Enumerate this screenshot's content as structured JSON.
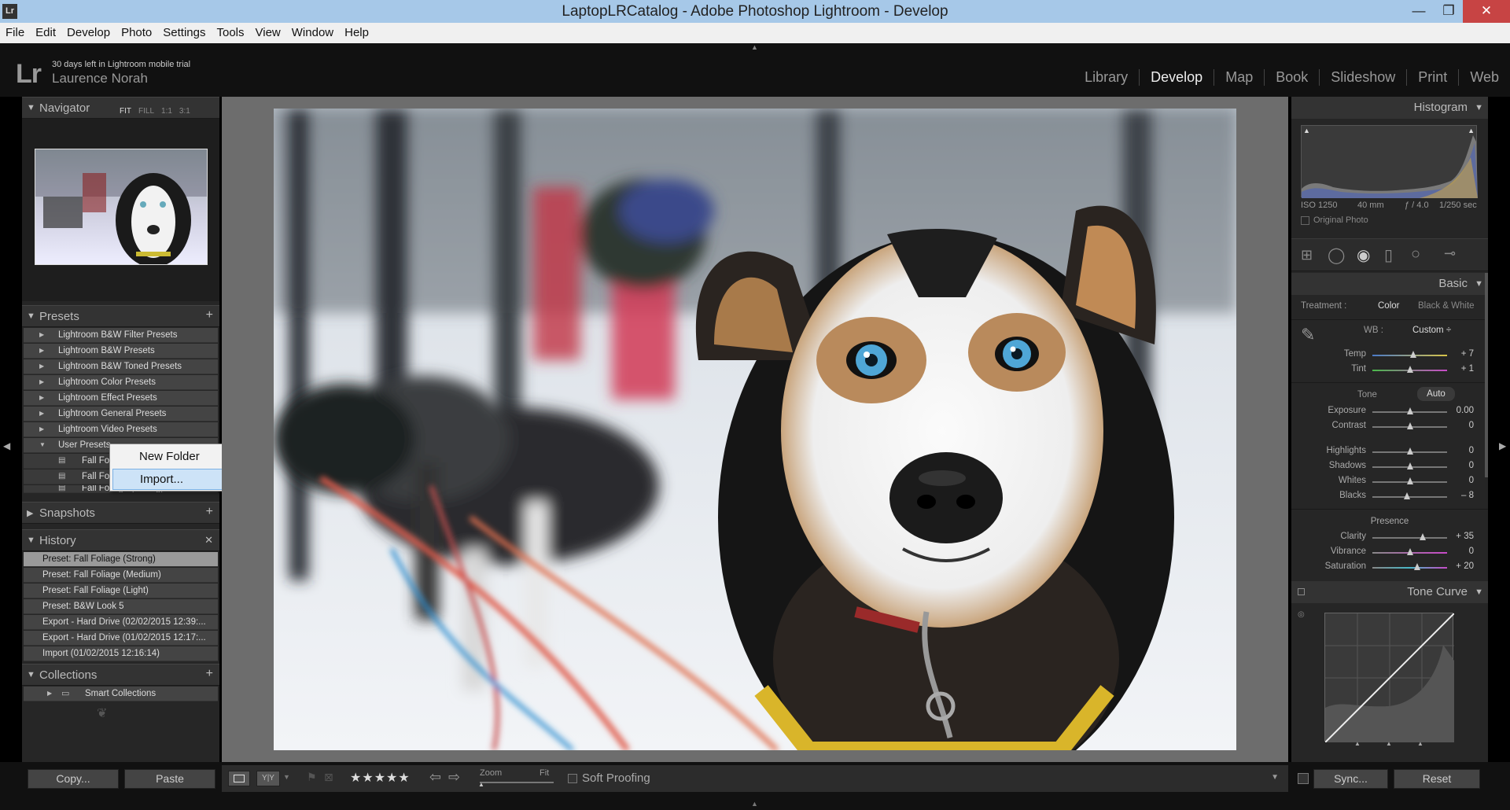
{
  "window": {
    "title": "LaptopLRCatalog - Adobe Photoshop Lightroom - Develop",
    "app_icon": "Lr",
    "minimize": "—",
    "maximize": "❐",
    "close": "✕"
  },
  "menu": [
    "File",
    "Edit",
    "Develop",
    "Photo",
    "Settings",
    "Tools",
    "View",
    "Window",
    "Help"
  ],
  "identity": {
    "logo": "Lr",
    "trial_text": "30 days left in Lightroom mobile trial",
    "user_name": "Laurence Norah"
  },
  "modules": [
    {
      "label": "Library",
      "active": false
    },
    {
      "label": "Develop",
      "active": true
    },
    {
      "label": "Map",
      "active": false
    },
    {
      "label": "Book",
      "active": false
    },
    {
      "label": "Slideshow",
      "active": false
    },
    {
      "label": "Print",
      "active": false
    },
    {
      "label": "Web",
      "active": false
    }
  ],
  "navigator": {
    "title": "Navigator",
    "zoom_options": [
      "FIT",
      "FILL",
      "1:1",
      "3:1"
    ]
  },
  "presets": {
    "title": "Presets",
    "folders": [
      "Lightroom B&W Filter Presets",
      "Lightroom B&W Presets",
      "Lightroom B&W Toned Presets",
      "Lightroom Color Presets",
      "Lightroom Effect Presets",
      "Lightroom General Presets",
      "Lightroom Video Presets",
      "User Presets"
    ],
    "user_items": [
      "Fall Fol",
      "Fall Fol",
      "Fall Foliage (Strong)"
    ]
  },
  "context_menu": {
    "items": [
      "New Folder",
      "Import..."
    ]
  },
  "snapshots": {
    "title": "Snapshots"
  },
  "history": {
    "title": "History",
    "items": [
      "Preset: Fall Foliage (Strong)",
      "Preset: Fall Foliage (Medium)",
      "Preset: Fall Foliage (Light)",
      "Preset: B&W Look 5",
      "Export - Hard Drive (02/02/2015 12:39:...",
      "Export - Hard Drive (01/02/2015 12:17:...",
      "Import (01/02/2015 12:16:14)"
    ]
  },
  "collections": {
    "title": "Collections",
    "items": [
      "Smart Collections"
    ]
  },
  "left_buttons": {
    "copy": "Copy...",
    "paste": "Paste"
  },
  "histogram": {
    "title": "Histogram",
    "iso": "ISO 1250",
    "focal": "40 mm",
    "aperture": "ƒ / 4.0",
    "shutter": "1/250 sec",
    "original_photo": "Original Photo"
  },
  "basic": {
    "title": "Basic",
    "treatment_label": "Treatment :",
    "treatment_color": "Color",
    "treatment_bw": "Black & White",
    "wb_label": "WB :",
    "wb_value": "Custom ÷",
    "tone_label": "Tone",
    "auto_label": "Auto",
    "presence_label": "Presence",
    "sliders": [
      {
        "name": "Temp",
        "value": "+ 7",
        "pos": 0.55
      },
      {
        "name": "Tint",
        "value": "+ 1",
        "pos": 0.51
      },
      {
        "name": "Exposure",
        "value": "0.00",
        "pos": 0.5
      },
      {
        "name": "Contrast",
        "value": "0",
        "pos": 0.5
      },
      {
        "name": "Highlights",
        "value": "0",
        "pos": 0.5
      },
      {
        "name": "Shadows",
        "value": "0",
        "pos": 0.5
      },
      {
        "name": "Whites",
        "value": "0",
        "pos": 0.5
      },
      {
        "name": "Blacks",
        "value": "– 8",
        "pos": 0.46
      },
      {
        "name": "Clarity",
        "value": "+ 35",
        "pos": 0.675
      },
      {
        "name": "Vibrance",
        "value": "0",
        "pos": 0.5
      },
      {
        "name": "Saturation",
        "value": "+ 20",
        "pos": 0.6
      }
    ]
  },
  "tone_curve": {
    "title": "Tone Curve"
  },
  "right_buttons": {
    "sync": "Sync...",
    "reset": "Reset"
  },
  "toolbar": {
    "zoom_label": "Zoom",
    "fit_label": "Fit",
    "soft_proofing": "Soft Proofing",
    "stars": "★★★★★"
  }
}
